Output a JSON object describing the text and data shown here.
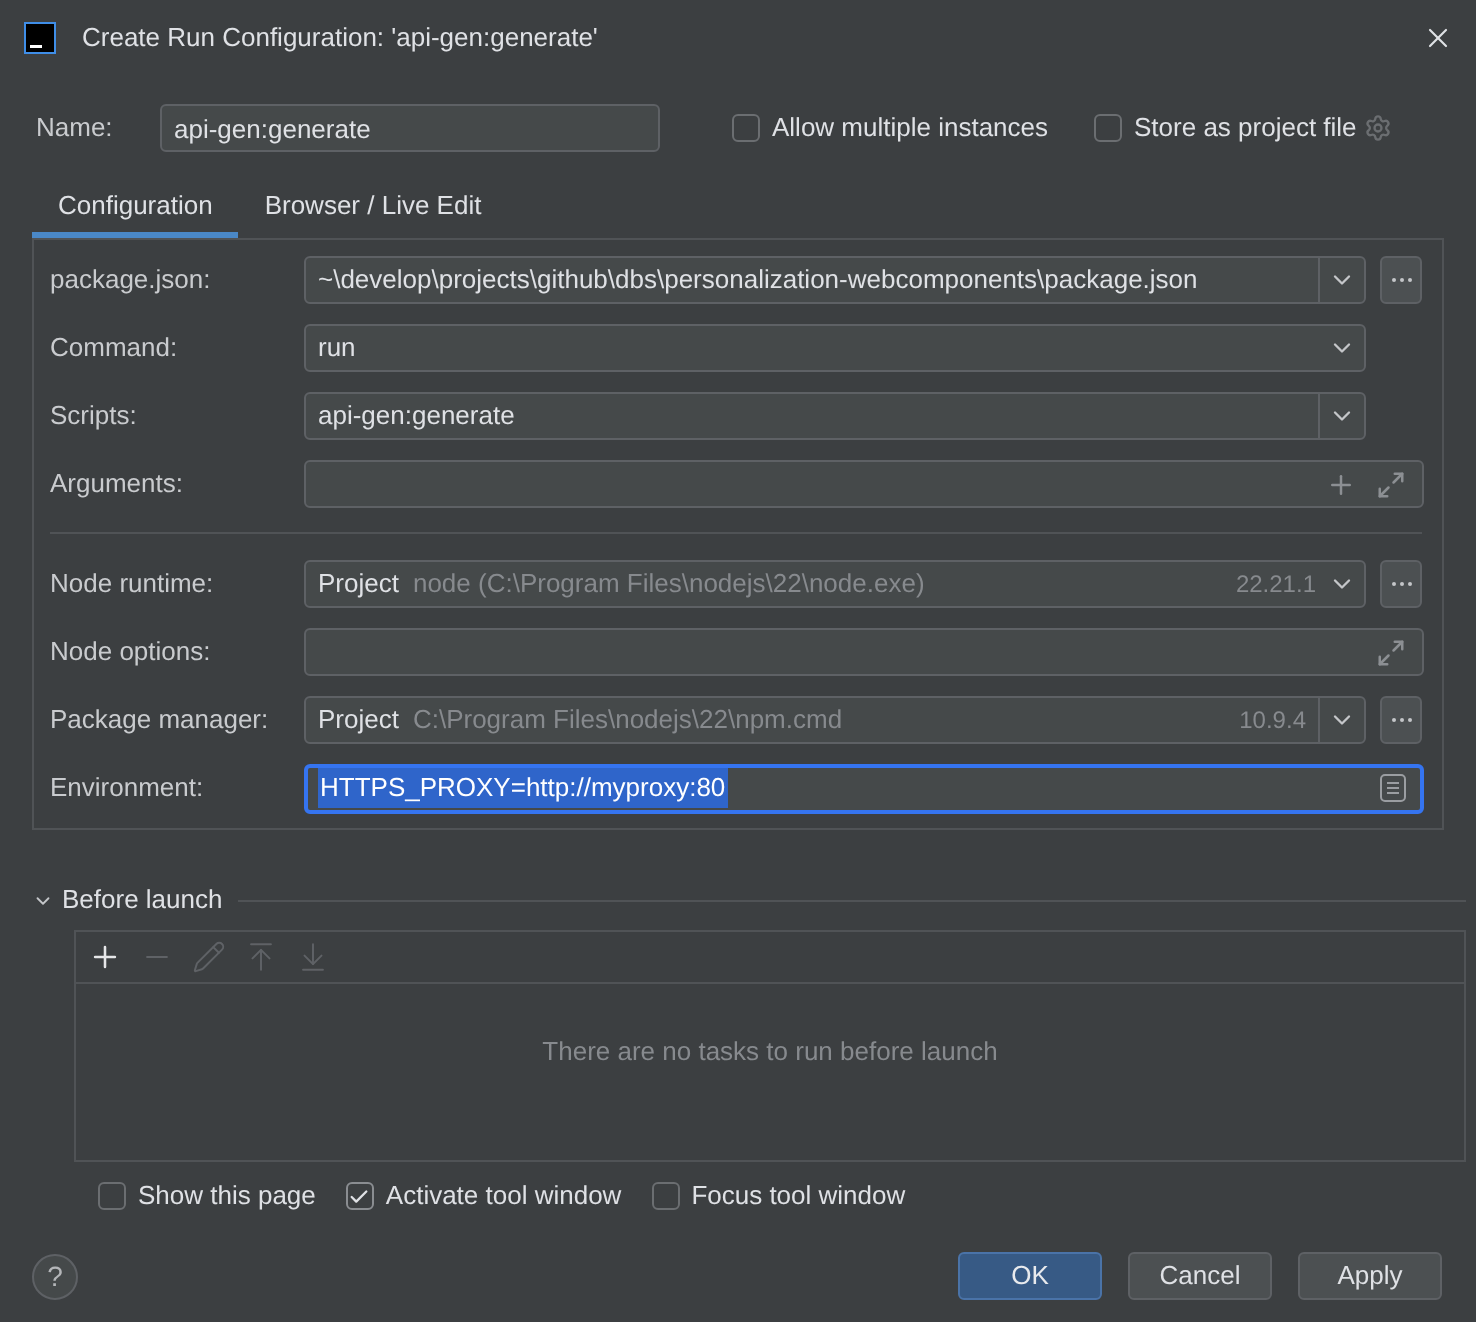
{
  "window": {
    "title": "Create Run Configuration: 'api-gen:generate'"
  },
  "name_field": {
    "label": "Name:",
    "value": "api-gen:generate"
  },
  "options": [
    {
      "label": "Allow multiple instances",
      "checked": false
    },
    {
      "label": "Store as project file",
      "checked": false
    }
  ],
  "tabs": [
    {
      "label": "Configuration",
      "selected": true
    },
    {
      "label": "Browser / Live Edit",
      "selected": false
    }
  ],
  "config_groups": [
    [
      {
        "kind": "combo",
        "label": "package.json:",
        "value": "~\\develop\\projects\\github\\dbs\\personalization-webcomponents\\package.json",
        "editable": true,
        "browse": true
      },
      {
        "kind": "combo",
        "label": "Command:",
        "value": "run",
        "editable": false,
        "browse": false
      },
      {
        "kind": "combo",
        "label": "Scripts:",
        "value": "api-gen:generate",
        "editable": true,
        "browse": false
      },
      {
        "kind": "expandable",
        "label": "Arguments:",
        "addable": true
      }
    ],
    [
      {
        "kind": "interpreter",
        "label": "Node runtime:",
        "value": "Project",
        "hint": "node (C:\\Program Files\\nodejs\\22\\node.exe)",
        "version": "22.21.1",
        "editable": false,
        "browse": true
      },
      {
        "kind": "expandable",
        "label": "Node options:",
        "addable": false
      },
      {
        "kind": "interpreter",
        "label": "Package manager:",
        "value": "Project",
        "hint": "C:\\Program Files\\nodejs\\22\\npm.cmd",
        "version": "10.9.4",
        "editable": true,
        "browse": true
      },
      {
        "kind": "env",
        "label": "Environment:",
        "value": "HTTPS_PROXY=http://myproxy:80",
        "focused": true,
        "text_selected": true
      }
    ]
  ],
  "before_launch": {
    "title": "Before launch",
    "expanded": true,
    "toolbar": [
      {
        "kind": "add",
        "disabled": false
      },
      {
        "kind": "remove",
        "disabled": true
      },
      {
        "kind": "edit",
        "disabled": true
      },
      {
        "kind": "move_up",
        "disabled": true
      },
      {
        "kind": "move_down",
        "disabled": true
      }
    ],
    "empty_text": "There are no tasks to run before launch"
  },
  "launch_options": [
    {
      "label": "Show this page",
      "checked": false
    },
    {
      "label": "Activate tool window",
      "checked": true
    },
    {
      "label": "Focus tool window",
      "checked": false
    }
  ],
  "help_button": "?",
  "buttons": [
    {
      "label": "OK",
      "kind": "primary"
    },
    {
      "label": "Cancel",
      "kind": "default"
    },
    {
      "label": "Apply",
      "kind": "default"
    }
  ]
}
